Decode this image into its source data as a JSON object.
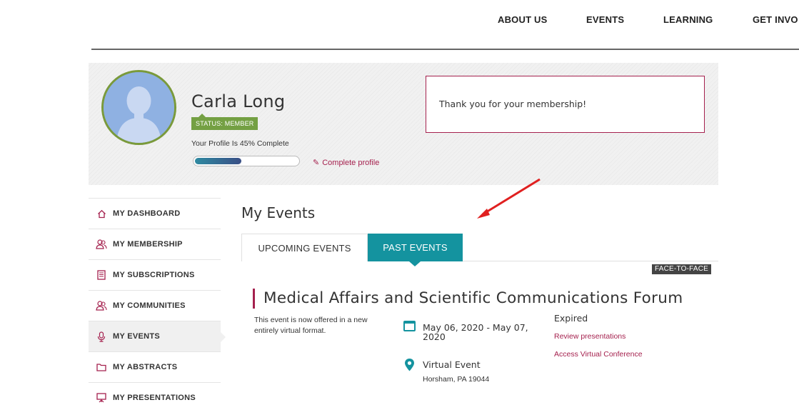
{
  "nav": {
    "items": [
      "ABOUT US",
      "EVENTS",
      "LEARNING",
      "GET INVO"
    ]
  },
  "profile": {
    "name": "Carla Long",
    "status": "STATUS: MEMBER",
    "completion_text": "Your Profile Is 45% Complete",
    "completion": 0.45,
    "complete_link": "Complete profile",
    "message": "Thank you for your membership!"
  },
  "sidebar": {
    "items": [
      {
        "label": "MY DASHBOARD",
        "icon": "home-icon"
      },
      {
        "label": "MY MEMBERSHIP",
        "icon": "users-icon"
      },
      {
        "label": "MY SUBSCRIPTIONS",
        "icon": "document-icon"
      },
      {
        "label": "MY COMMUNITIES",
        "icon": "users-icon"
      },
      {
        "label": "MY EVENTS",
        "icon": "microphone-icon",
        "active": true
      },
      {
        "label": "MY ABSTRACTS",
        "icon": "folder-icon"
      },
      {
        "label": "MY PRESENTATIONS",
        "icon": "presentation-icon"
      }
    ]
  },
  "main": {
    "title": "My Events",
    "tabs": [
      {
        "label": "UPCOMING EVENTS",
        "active": false
      },
      {
        "label": "PAST EVENTS",
        "active": true
      }
    ],
    "event": {
      "type": "FACE-TO-FACE",
      "title": "Medical Affairs and Scientific Communications Forum",
      "description": "This event is now offered in a new entirely virtual format.",
      "dates": "May 06, 2020 - May 07, 2020",
      "venue": "Virtual Event",
      "location": "Horsham, PA 19044",
      "status": "Expired",
      "links": [
        "Review presentations",
        "Access Virtual Conference"
      ]
    }
  },
  "colors": {
    "accent": "#a5214e",
    "teal": "#14939f",
    "member_green": "#74a043"
  }
}
